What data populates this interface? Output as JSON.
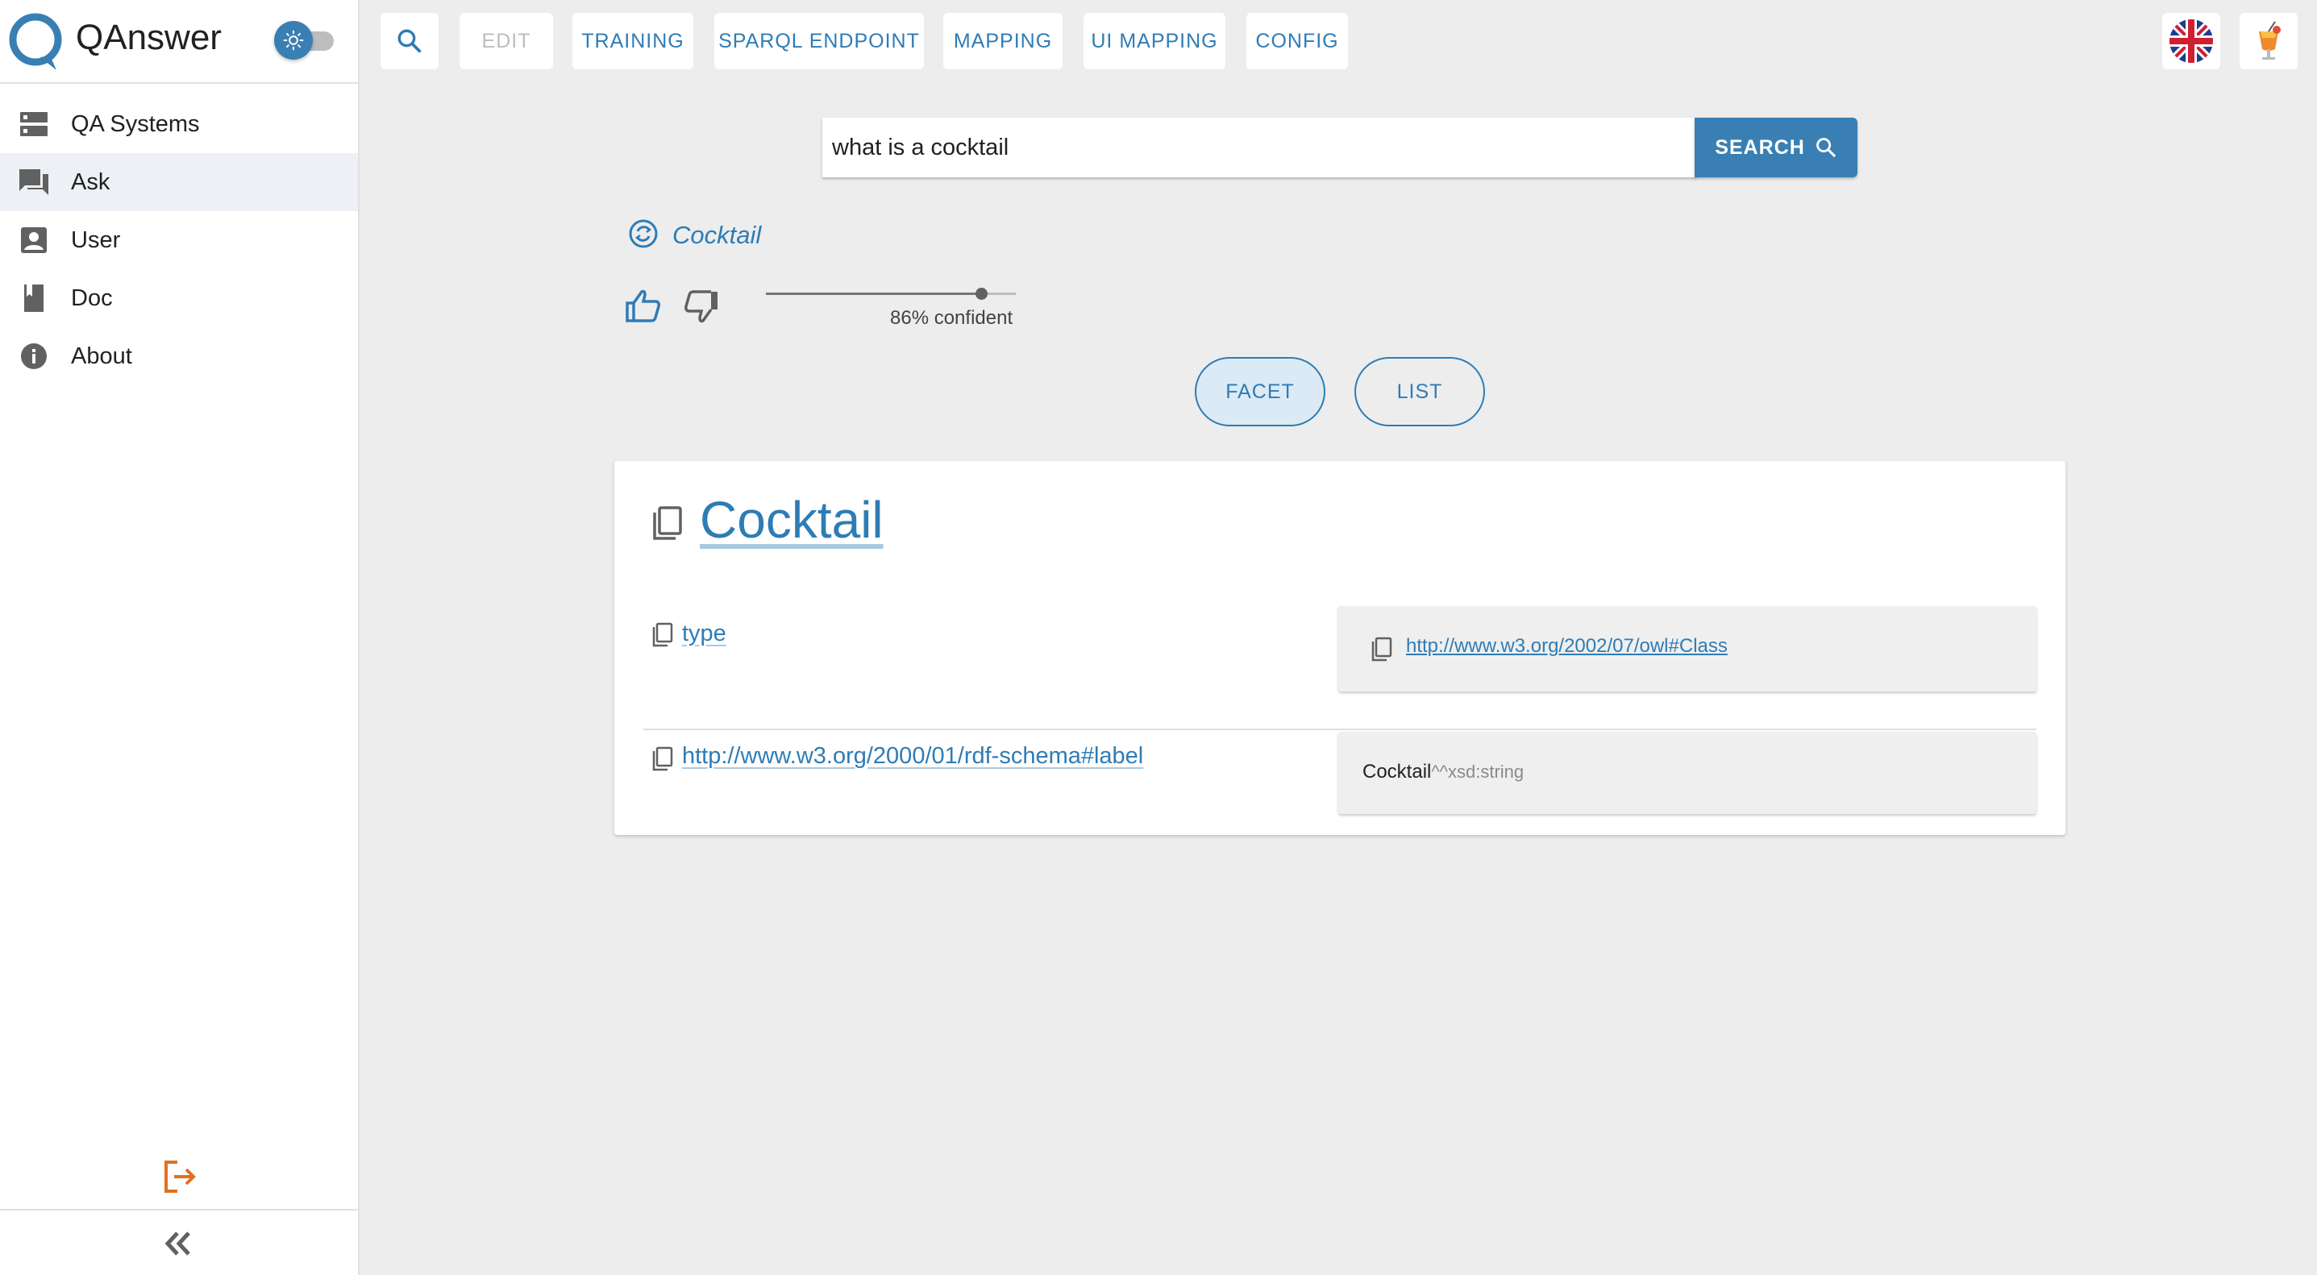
{
  "app": {
    "name": "QAnswer"
  },
  "sidebar": {
    "items": [
      {
        "label": "QA Systems",
        "icon": "storage-icon"
      },
      {
        "label": "Ask",
        "icon": "forum-icon",
        "active": true
      },
      {
        "label": "User",
        "icon": "account-box-icon"
      },
      {
        "label": "Doc",
        "icon": "book-icon"
      },
      {
        "label": "About",
        "icon": "info-icon"
      }
    ],
    "logout_icon": "logout-icon",
    "collapse_icon": "double-chevron-left-icon"
  },
  "toolbar": {
    "edit_label": "EDIT",
    "training_label": "TRAINING",
    "sparql_label": "SPARQL ENDPOINT",
    "mapping_label": "MAPPING",
    "ui_mapping_label": "UI MAPPING",
    "config_label": "CONFIG"
  },
  "search": {
    "value": "what is a cocktail",
    "button_label": "SEARCH"
  },
  "answer": {
    "title": "Cocktail",
    "confidence": 0.86,
    "confidence_label": "86% confident"
  },
  "views": {
    "facet_label": "FACET",
    "list_label": "LIST",
    "selected": "FACET"
  },
  "card": {
    "title": "Cocktail",
    "rows": [
      {
        "key": "type",
        "value": "http://www.w3.org/2002/07/owl#Class"
      },
      {
        "key": "http://www.w3.org/2000/01/rdf-schema#label",
        "value": "Cocktail",
        "datatype": "^^xsd:string"
      }
    ]
  },
  "colors": {
    "accent": "#2e7cb5",
    "primary_button": "#3a7fb3",
    "background": "#ededed",
    "logout": "#e07020"
  }
}
